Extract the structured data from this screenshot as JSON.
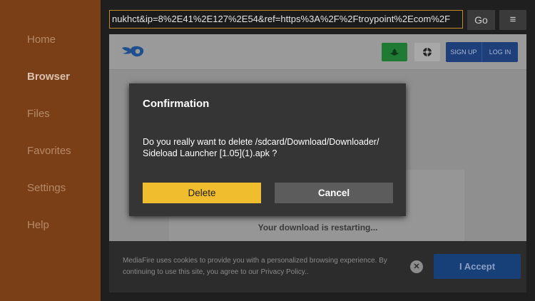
{
  "sidebar": {
    "items": [
      {
        "label": "Home"
      },
      {
        "label": "Browser",
        "active": true
      },
      {
        "label": "Files"
      },
      {
        "label": "Favorites"
      },
      {
        "label": "Settings"
      },
      {
        "label": "Help"
      }
    ]
  },
  "toolbar": {
    "url": "nukhct&ip=8%2E41%2E127%2E54&ref=https%3A%2F%2Ftroypoint%2Ecom%2F",
    "go_label": "Go",
    "menu_icon": "≡"
  },
  "webpage": {
    "logo_icon": "mediafire-logo",
    "green_button_icon": "download-icon",
    "gray_button_icon": "support-icon",
    "signup_label": "SIGN UP",
    "login_label": "LOG IN",
    "restart_text": "Your download is restarting..."
  },
  "cookie_banner": {
    "text": "MediaFire uses cookies to provide you with a personalized browsing experience. By continuing to use this site, you agree to our Privacy Policy..",
    "close_symbol": "✕",
    "accept_label": "I Accept"
  },
  "dialog": {
    "title": "Confirmation",
    "message_line1": "Do you really want to delete /sdcard/Download/Downloader/",
    "message_line2": "Sideload Launcher [1.05](1).apk ?",
    "delete_label": "Delete",
    "cancel_label": "Cancel"
  },
  "colors": {
    "sidebar_bg": "#7a3f16",
    "accent_border": "#c48a2a",
    "delete_button": "#f0bd2e",
    "cancel_button": "#5c5c5c"
  }
}
